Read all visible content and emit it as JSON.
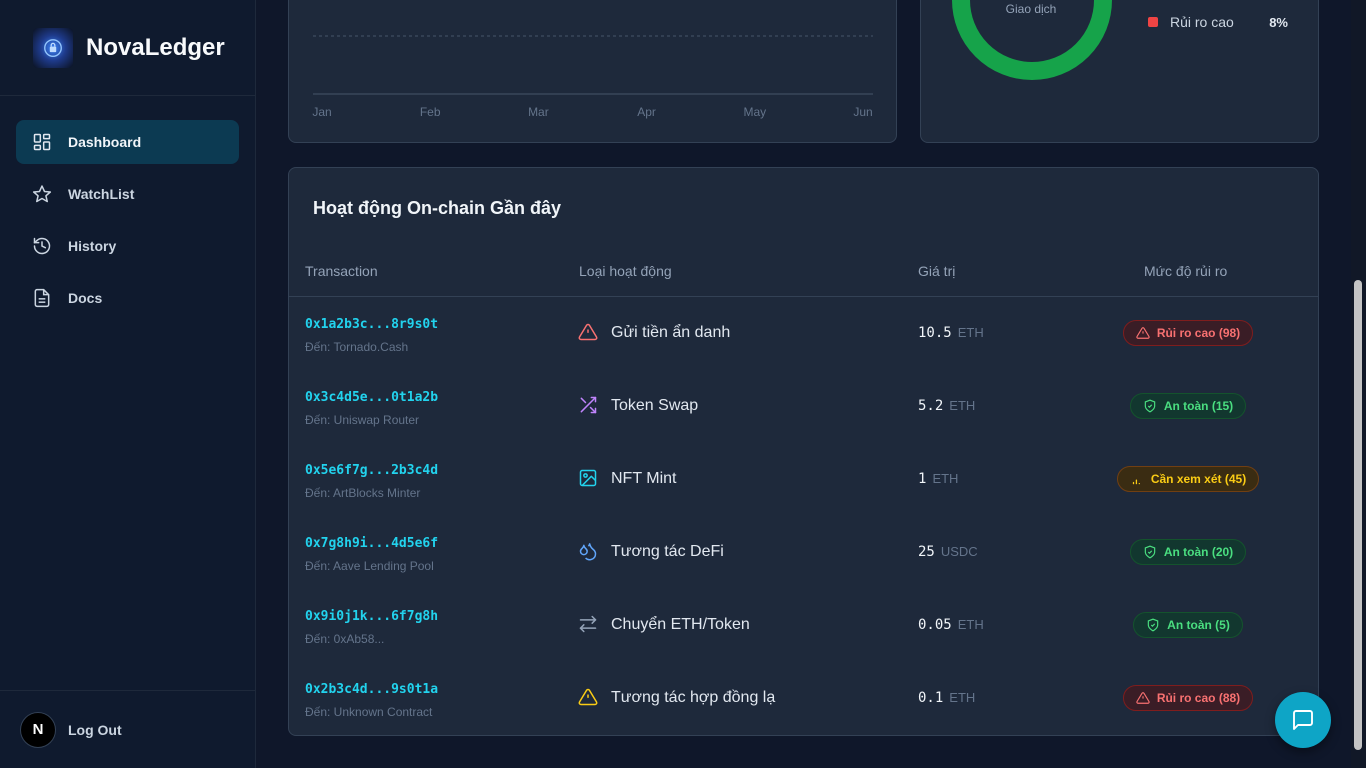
{
  "brand": {
    "name": "NovaLedger"
  },
  "sidebar": {
    "items": [
      {
        "label": "Dashboard",
        "icon": "dashboard-icon",
        "active": true
      },
      {
        "label": "WatchList",
        "icon": "star-icon",
        "active": false
      },
      {
        "label": "History",
        "icon": "history-icon",
        "active": false
      },
      {
        "label": "Docs",
        "icon": "document-icon",
        "active": false
      }
    ],
    "user_initial": "N",
    "logout_label": "Log Out"
  },
  "chart": {
    "months": [
      "Jan",
      "Feb",
      "Mar",
      "Apr",
      "May",
      "Jun"
    ]
  },
  "donut": {
    "center_label": "Giao dịch",
    "legend": [
      {
        "name": "Rủi ro cao",
        "value": "8%",
        "color": "#ef4444"
      }
    ]
  },
  "activity": {
    "title": "Hoạt động On-chain Gần đây",
    "headers": {
      "tx": "Transaction",
      "type": "Loại hoạt động",
      "value": "Giá trị",
      "risk": "Mức độ rủi ro"
    },
    "rows": [
      {
        "hash": "0x1a2b3c...8r9s0t",
        "to": "Đến: Tornado.Cash",
        "icon": "warning-icon",
        "activity": "Gửi tiền ẩn danh",
        "amount": "10.5",
        "unit": "ETH",
        "risk": "Rủi ro cao (98)",
        "level": "high"
      },
      {
        "hash": "0x3c4d5e...0t1a2b",
        "to": "Đến: Uniswap Router",
        "icon": "shuffle-icon",
        "activity": "Token Swap",
        "amount": "5.2",
        "unit": "ETH",
        "risk": "An toàn (15)",
        "level": "safe"
      },
      {
        "hash": "0x5e6f7g...2b3c4d",
        "to": "Đến: ArtBlocks Minter",
        "icon": "image-icon",
        "activity": "NFT Mint",
        "amount": "1",
        "unit": "ETH",
        "risk": "Cần xem xét (45)",
        "level": "review"
      },
      {
        "hash": "0x7g8h9i...4d5e6f",
        "to": "Đến: Aave Lending Pool",
        "icon": "droplets-icon",
        "activity": "Tương tác DeFi",
        "amount": "25",
        "unit": "USDC",
        "risk": "An toàn (20)",
        "level": "safe"
      },
      {
        "hash": "0x9i0j1k...6f7g8h",
        "to": "Đến: 0xAb58...",
        "icon": "transfer-icon",
        "activity": "Chuyển ETH/Token",
        "amount": "0.05",
        "unit": "ETH",
        "risk": "An toàn (5)",
        "level": "safe"
      },
      {
        "hash": "0x2b3c4d...9s0t1a",
        "to": "Đến: Unknown Contract",
        "icon": "caution-icon",
        "activity": "Tương tác hợp đồng lạ",
        "amount": "0.1",
        "unit": "ETH",
        "risk": "Rủi ro cao (88)",
        "level": "high"
      }
    ]
  },
  "colors": {
    "accent": "#22d3ee",
    "danger": "#ef4444",
    "safe": "#22c55e",
    "warn": "#eab308",
    "donut": "#16a34a"
  }
}
